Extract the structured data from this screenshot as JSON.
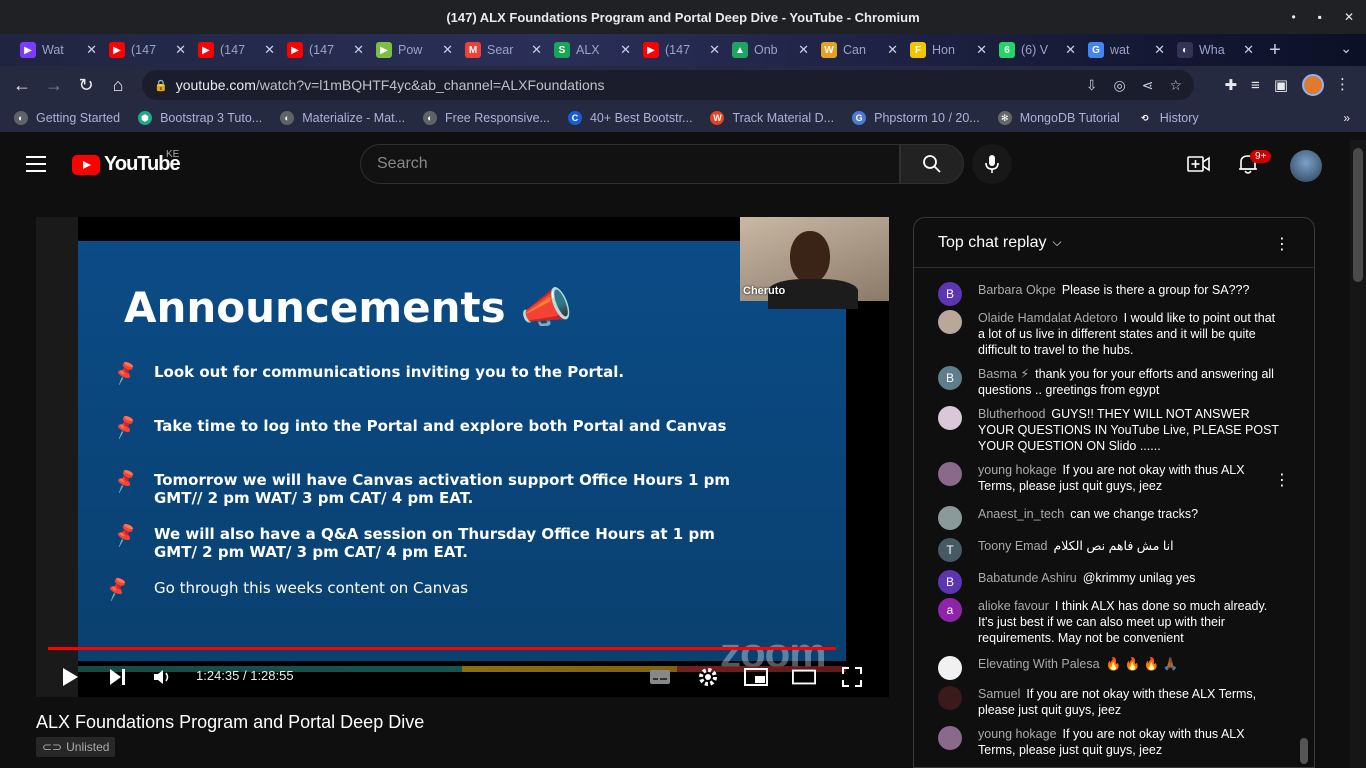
{
  "window": {
    "title": "(147) ALX Foundations Program and Portal Deep Dive - YouTube - Chromium",
    "controls": [
      "•",
      "▪",
      "✕"
    ]
  },
  "tabs": [
    {
      "label": "Wat",
      "color": "#7a3cff",
      "glyph": "▶"
    },
    {
      "label": "(147",
      "color": "#ff0000",
      "glyph": "▶"
    },
    {
      "label": "(147",
      "color": "#ff0000",
      "glyph": "▶"
    },
    {
      "label": "(147",
      "color": "#ff0000",
      "glyph": "▶"
    },
    {
      "label": "Pow",
      "color": "#7bc043",
      "glyph": "▶"
    },
    {
      "label": "Sear",
      "color": "#ea4335",
      "glyph": "M"
    },
    {
      "label": "ALX",
      "color": "#18a558",
      "glyph": "S"
    },
    {
      "label": "(147",
      "color": "#ff0000",
      "glyph": "▶"
    },
    {
      "label": "Onb",
      "color": "#1fa463",
      "glyph": "▲"
    },
    {
      "label": "Can",
      "color": "#e6a320",
      "glyph": "W"
    },
    {
      "label": "Hon",
      "color": "#f5c400",
      "glyph": "F"
    },
    {
      "label": "(6) V",
      "color": "#25d366",
      "glyph": "6"
    },
    {
      "label": "wat",
      "color": "#4285f4",
      "glyph": "G"
    },
    {
      "label": "Wha",
      "color": "#333355",
      "glyph": "◐"
    }
  ],
  "address": {
    "host": "youtube.com",
    "path": "/watch?v=l1mBQHTF4yc&ab_channel=ALXFoundations"
  },
  "bookmarks": [
    {
      "label": "Getting Started",
      "color": "#5f6368",
      "glyph": "◐"
    },
    {
      "label": "Bootstrap 3 Tuto...",
      "color": "#1fa88a",
      "glyph": "⬢"
    },
    {
      "label": "Materialize - Mat...",
      "color": "#5f6368",
      "glyph": "◐"
    },
    {
      "label": "Free Responsive...",
      "color": "#5f6368",
      "glyph": "◐"
    },
    {
      "label": "40+ Best Bootstr...",
      "color": "#1a5bd6",
      "glyph": "C"
    },
    {
      "label": "Track Material D...",
      "color": "#e8411f",
      "glyph": "W"
    },
    {
      "label": "Phpstorm 10 / 20...",
      "color": "#4a7ad6",
      "glyph": "G"
    },
    {
      "label": "MongoDB Tutorial",
      "color": "#666",
      "glyph": "✻"
    },
    {
      "label": "History",
      "color": "#262a40",
      "glyph": "⟲"
    }
  ],
  "youtube": {
    "logo_text": "YouTube",
    "country": "KE",
    "search_placeholder": "Search",
    "notifications": "9+"
  },
  "slide": {
    "title": "Announcements 📣",
    "bullets": [
      "Look out for communications inviting you to the Portal.",
      "Take time to log into the Portal and explore both Portal and Canvas",
      "Tomorrow we will have Canvas activation support Office Hours 1 pm GMT// 2 pm WAT/ 3 pm CAT/ 4 pm EAT.",
      "We will also have a Q&A session on Thursday Office Hours at 1 pm GMT/ 2 pm WAT/ 3 pm CAT/ 4 pm EAT.",
      "Go through this weeks content on Canvas"
    ],
    "camera_name": "Cheruto",
    "watermark": "zoom"
  },
  "player": {
    "time": "1:24:35 / 1:28:55",
    "progress": 0.95
  },
  "video": {
    "title": "ALX Foundations Program and Portal Deep Dive",
    "visibility": "Unlisted"
  },
  "chat": {
    "header": "Top chat replay",
    "messages": [
      {
        "author": "Barbara Okpe",
        "text": "Please is there a group for SA???",
        "avatar": "B",
        "color": "#5e35b1"
      },
      {
        "author": "Olaide Hamdalat Adetoro",
        "text": "I would like to point out that a lot of us live in different states and it will be quite difficult to travel to the hubs.",
        "avatar": "",
        "color": "#b9a89a"
      },
      {
        "author": "Basma ⚡",
        "text": "thank you for your efforts and answering all questions .. greetings from egypt",
        "avatar": "B",
        "color": "#607d8b"
      },
      {
        "author": "Blutherhood",
        "text": "GUYS!! THEY WILL NOT ANSWER YOUR QUESTIONS IN YouTube Live, PLEASE POST YOUR QUESTION ON Slido ......",
        "avatar": "",
        "color": "#d8c8d8"
      },
      {
        "author": "young hokage",
        "text": "If you are not okay with thus ALX Terms, please just quit guys, jeez",
        "avatar": "",
        "color": "#8a6a8a"
      },
      {
        "author": "Anaest_in_tech",
        "text": "can we change tracks?",
        "avatar": "",
        "color": "#8a9a9a"
      },
      {
        "author": "Toony Emad",
        "text": "انا مش فاهم نص الكلام",
        "avatar": "T",
        "color": "#455a64"
      },
      {
        "author": "Babatunde Ashiru",
        "text": "@krimmy unilag yes",
        "avatar": "B",
        "color": "#5e35b1"
      },
      {
        "author": "alioke favour",
        "text": "I think ALX has done so much already. It's just best if we can also meet up with their requirements. May not be convenient",
        "avatar": "a",
        "color": "#8e24aa"
      },
      {
        "author": "Elevating With Palesa",
        "text": "🔥 🔥 🔥 🙏🏾",
        "avatar": "",
        "color": "#f1f1f1"
      },
      {
        "author": "Samuel",
        "text": "If you are not okay with these ALX Terms, please just quit guys, jeez",
        "avatar": "",
        "color": "#3a1a1a"
      },
      {
        "author": "young hokage",
        "text": "If you are not okay with thus ALX Terms, please just quit guys, jeez",
        "avatar": "",
        "color": "#8a6a8a"
      }
    ]
  }
}
